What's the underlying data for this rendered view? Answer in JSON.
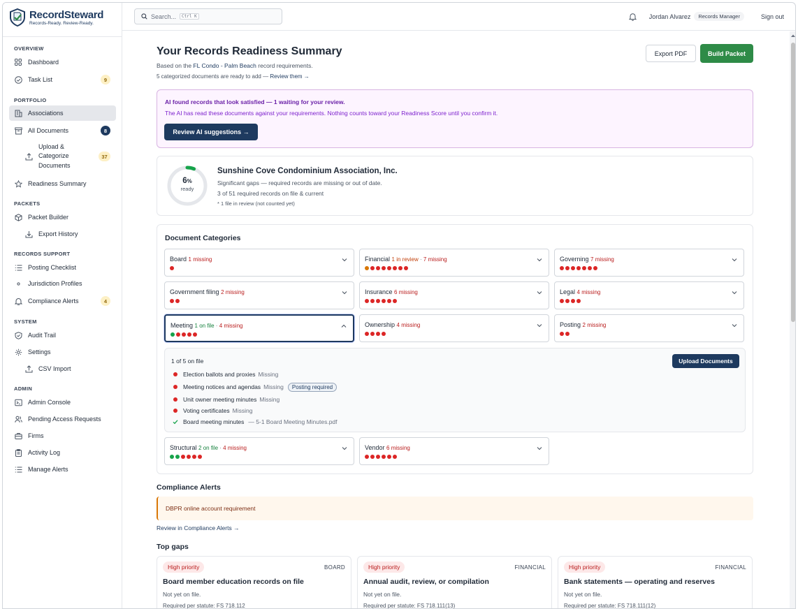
{
  "brand": {
    "name": "RecordSteward",
    "tagline": "Records-Ready. Review-Ready."
  },
  "sidebar": {
    "sections": [
      {
        "label": "OVERVIEW"
      },
      {
        "label": "PORTFOLIO"
      },
      {
        "label": "PACKETS"
      },
      {
        "label": "RECORDS SUPPORT"
      },
      {
        "label": "SYSTEM"
      },
      {
        "label": "ADMIN"
      }
    ],
    "items": [
      {
        "label": "Dashboard",
        "icon": "grid-icon"
      },
      {
        "label": "Task List",
        "icon": "check-circle-icon",
        "badge": "9"
      },
      {
        "label": "Associations",
        "icon": "building-icon"
      },
      {
        "label": "All Documents",
        "icon": "archive-icon",
        "badge": "8"
      },
      {
        "label": "Upload & Categorize Documents",
        "label_lines": [
          "Upload &",
          "Categorize",
          "Documents"
        ],
        "icon": "upload-icon",
        "badge": "37"
      },
      {
        "label": "Readiness Summary",
        "icon": "star-icon"
      },
      {
        "label": "Packet Builder",
        "icon": "box-icon"
      },
      {
        "label": "Export History",
        "icon": "download-icon"
      },
      {
        "label": "Posting Checklist",
        "icon": "list-icon"
      },
      {
        "label": "Jurisdiction Profiles",
        "icon": "dot-icon"
      },
      {
        "label": "Compliance Alerts",
        "icon": "bell-icon",
        "badge": "4"
      },
      {
        "label": "Audit Trail",
        "icon": "shield-icon"
      },
      {
        "label": "Settings",
        "icon": "gear-icon"
      },
      {
        "label": "CSV Import",
        "icon": "upload-icon"
      },
      {
        "label": "Admin Console",
        "icon": "terminal-icon"
      },
      {
        "label": "Pending Access Requests",
        "icon": "users-icon"
      },
      {
        "label": "Firms",
        "icon": "briefcase-icon"
      },
      {
        "label": "Activity Log",
        "icon": "clipboard-icon"
      },
      {
        "label": "Manage Alerts",
        "icon": "list-icon"
      }
    ]
  },
  "topbar": {
    "search_placeholder": "Search...",
    "shortcut": "Ctrl K",
    "user": "Jordan Alvarez",
    "role": "Records Manager",
    "signout": "Sign out"
  },
  "header": {
    "title": "Your Records Readiness Summary",
    "based_prefix": "Based on the",
    "profile": "FL Condo - Palm Beach",
    "based_suffix": "record requirements.",
    "ready_note": "5 categorized documents are ready to add —",
    "review_link": "Review them →",
    "export_label": "Export PDF",
    "build_label": "Build Packet"
  },
  "ai_banner": {
    "title": "AI found records that look satisfied — 1 waiting for your review.",
    "body": "The AI has read these documents against your requirements. Nothing counts toward your Readiness Score until you confirm it.",
    "button": "Review AI suggestions →"
  },
  "association": {
    "name": "Sunshine Cove Condominium Association, Inc.",
    "score": "6",
    "score_unit": "%",
    "score_label": "ready",
    "score_fraction": 0.06,
    "status": "Significant gaps — required records are missing or out of date.",
    "count": "3 of 51 required records on file & current",
    "review_note": "* 1 file in review (not counted yet)"
  },
  "categories": {
    "title": "Document Categories",
    "items": [
      {
        "name": "Board",
        "status": "1 missing",
        "dots": [
          "r"
        ]
      },
      {
        "name": "Financial",
        "review": "1 in review",
        "sep": " · ",
        "status": "7 missing",
        "dots": [
          "o",
          "r",
          "r",
          "r",
          "r",
          "r",
          "r",
          "r"
        ]
      },
      {
        "name": "Governing",
        "status": "7 missing",
        "dots": [
          "r",
          "r",
          "r",
          "r",
          "r",
          "r",
          "r"
        ]
      },
      {
        "name": "Government filing",
        "status": "2 missing",
        "dots": [
          "r",
          "r"
        ]
      },
      {
        "name": "Insurance",
        "status": "6 missing",
        "dots": [
          "r",
          "r",
          "r",
          "r",
          "r",
          "r"
        ]
      },
      {
        "name": "Legal",
        "status": "4 missing",
        "dots": [
          "r",
          "r",
          "r",
          "r"
        ]
      },
      {
        "name": "Meeting",
        "onfile": "1 on file",
        "sep": " · ",
        "status": "4 missing",
        "dots": [
          "g",
          "r",
          "r",
          "r",
          "r"
        ]
      },
      {
        "name": "Ownership",
        "status": "4 missing",
        "dots": [
          "r",
          "r",
          "r",
          "r"
        ]
      },
      {
        "name": "Posting",
        "status": "2 missing",
        "dots": [
          "r",
          "r"
        ]
      },
      {
        "name": "Structural",
        "onfile": "2 on file",
        "sep": " · ",
        "status": "4 missing",
        "dots": [
          "g",
          "g",
          "r",
          "r",
          "r",
          "r"
        ]
      },
      {
        "name": "Vendor",
        "status": "6 missing",
        "dots": [
          "r",
          "r",
          "r",
          "r",
          "r",
          "r"
        ]
      }
    ],
    "expanded": {
      "summary": "1 of 5 on file",
      "upload_label": "Upload Documents",
      "rows": [
        {
          "label": "Election ballots and proxies",
          "status": "Missing"
        },
        {
          "label": "Meeting notices and agendas",
          "status": "Missing",
          "tag": "Posting required"
        },
        {
          "label": "Unit owner meeting minutes",
          "status": "Missing"
        },
        {
          "label": "Voting certificates",
          "status": "Missing"
        },
        {
          "label": "Board meeting minutes",
          "status": "— 5-1 Board Meeting Minutes.pdf"
        }
      ]
    }
  },
  "compliance": {
    "title": "Compliance Alerts",
    "alert": "DBPR online account requirement",
    "link": "Review in Compliance Alerts →"
  },
  "gaps": {
    "title": "Top gaps",
    "items": [
      {
        "priority": "High priority",
        "kind": "BOARD",
        "title": "Board member education records on file",
        "status": "Not yet on file.",
        "req": "Required per statute: FS 718.112"
      },
      {
        "priority": "High priority",
        "kind": "FINANCIAL",
        "title": "Annual audit, review, or compilation",
        "status": "Not yet on file.",
        "req": "Required per statute: FS 718.111(13)"
      },
      {
        "priority": "High priority",
        "kind": "FINANCIAL",
        "title": "Bank statements — operating and reserves",
        "status": "Not yet on file.",
        "req": "Required per statute: FS 718.111(12)"
      }
    ]
  },
  "colors": {
    "navy": "#1e3a5f",
    "green": "#2e8b47",
    "missing": "#dc2626",
    "onfile": "#16a34a",
    "review": "#d97706",
    "ai_bg": "#fdf4ff",
    "alert_bg": "#fff7ed"
  }
}
